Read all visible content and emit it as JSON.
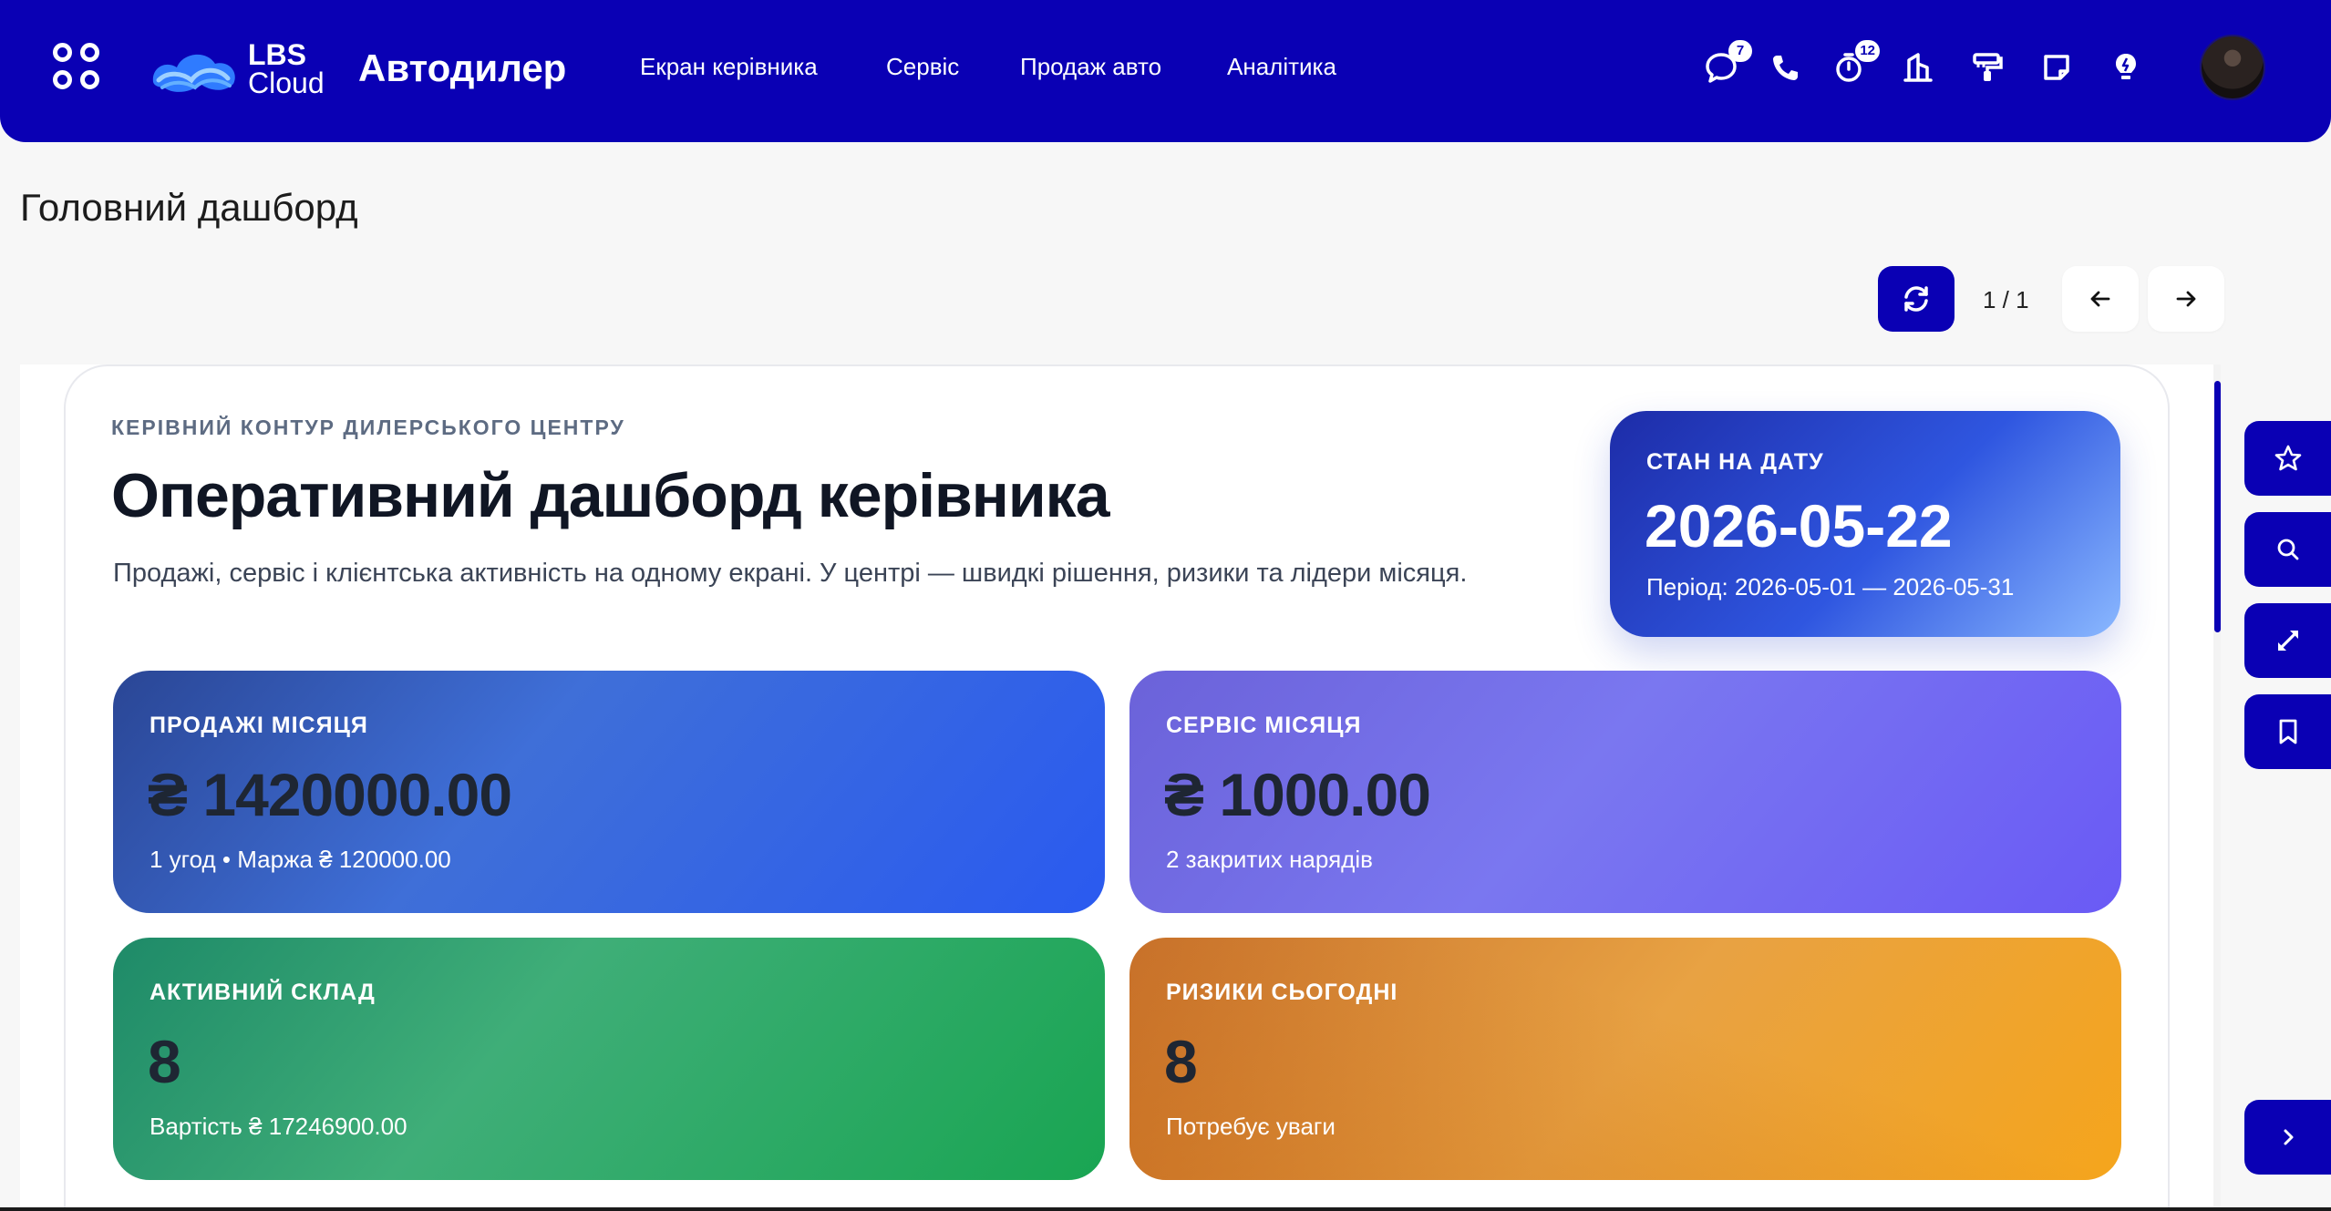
{
  "topbar": {
    "logo_line1": "LBS",
    "logo_line2": "Cloud",
    "app_title": "Автодилер",
    "nav": [
      "Екран керівника",
      "Сервіс",
      "Продаж авто",
      "Аналітика"
    ],
    "icons": [
      {
        "name": "chat-icon",
        "badge": "7"
      },
      {
        "name": "phone-icon",
        "badge": ""
      },
      {
        "name": "timer-icon",
        "badge": "12"
      },
      {
        "name": "bank-icon",
        "badge": ""
      },
      {
        "name": "paint-roller-icon",
        "badge": ""
      },
      {
        "name": "note-icon",
        "badge": ""
      },
      {
        "name": "lightbulb-icon",
        "badge": ""
      }
    ],
    "accent_color": "#0a00b4"
  },
  "page": {
    "title": "Головний дашборд",
    "pager": "1 / 1"
  },
  "dashboard": {
    "eyebrow": "КЕРІВНИЙ КОНТУР ДИЛЕРСЬКОГО ЦЕНТРУ",
    "title": "Оперативний дашборд керівника",
    "subtitle": "Продажі, сервіс і клієнтська активність на одному екрані. У центрі — швидкі рішення, ризики та лідери місяця.",
    "date_card": {
      "label": "СТАН НА ДАТУ",
      "value": "2026-05-22",
      "period": "Період: 2026-05-01 — 2026-05-31"
    },
    "kpis": {
      "sales": {
        "label": "ПРОДАЖІ МІСЯЦЯ",
        "value": "₴ 1420000.00",
        "note": "1 угод • Маржа ₴ 120000.00"
      },
      "service": {
        "label": "СЕРВІС МІСЯЦЯ",
        "value": "₴ 1000.00",
        "note": "2 закритих нарядів"
      },
      "stock": {
        "label": "АКТИВНИЙ СКЛАД",
        "value": "8",
        "note": "Вартість ₴ 17246900.00"
      },
      "risk": {
        "label": "РИЗИКИ СЬОГОДНІ",
        "value": "8",
        "note": "Потребує уваги"
      }
    }
  },
  "side_buttons": [
    "star-icon",
    "search-icon",
    "expand-icon",
    "bookmark-icon",
    "chevron-right-icon"
  ]
}
